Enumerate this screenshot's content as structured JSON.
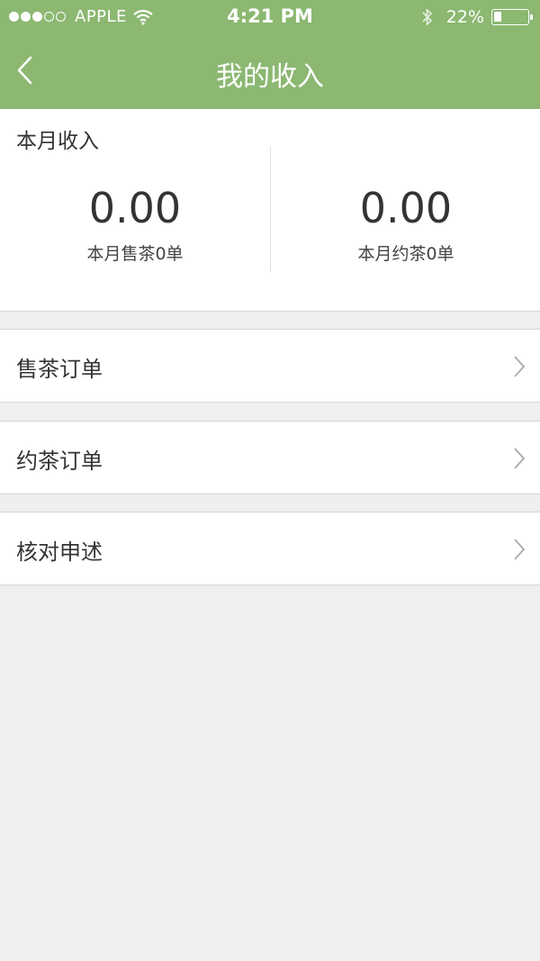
{
  "status_bar": {
    "carrier": "APPLE",
    "time": "4:21 PM",
    "battery": "22%"
  },
  "nav": {
    "title": "我的收入",
    "back_icon": "chevron-left-icon"
  },
  "income": {
    "title": "本月收入",
    "left": {
      "value": "0.00",
      "label": "本月售茶0单"
    },
    "right": {
      "value": "0.00",
      "label": "本月约茶0单"
    }
  },
  "menu": [
    {
      "label": "售茶订单"
    },
    {
      "label": "约茶订单"
    },
    {
      "label": "核对申述"
    }
  ],
  "colors": {
    "header": "#8cb872",
    "background": "#efefef"
  }
}
